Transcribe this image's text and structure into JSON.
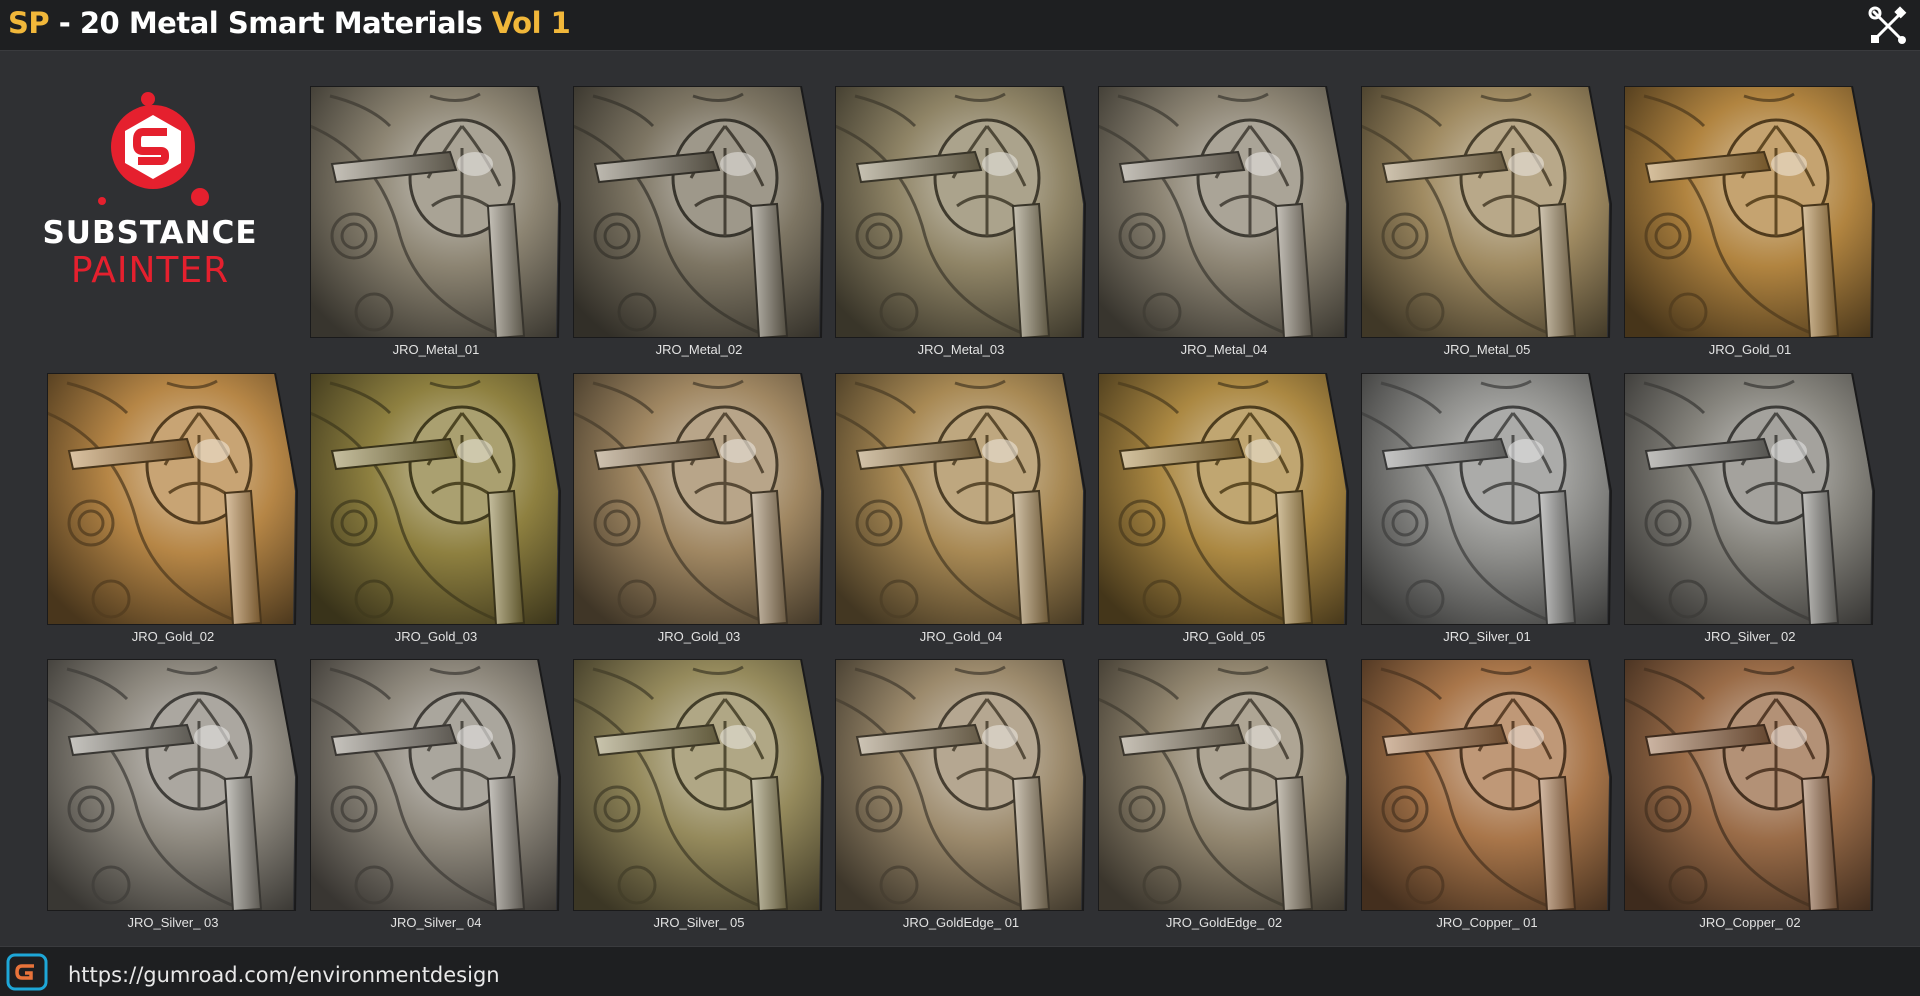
{
  "header": {
    "title_sp": "SP",
    "title_main": " - 20 Metal Smart Materials ",
    "title_vol": "Vol 1",
    "tools_icon": "tools-icon"
  },
  "logo": {
    "line1": "SUBSTANCE",
    "line2": "PAINTER",
    "brand_red": "#e5202e"
  },
  "colors": {
    "accent": "#f1b73a",
    "background": "#2f3033",
    "bar": "#1e1f21"
  },
  "materials": [
    {
      "label": "JRO_Metal_01",
      "tint": "#8c8472"
    },
    {
      "label": "JRO_Metal_02",
      "tint": "#7d7563"
    },
    {
      "label": "JRO_Metal_03",
      "tint": "#8f8466"
    },
    {
      "label": "JRO_Metal_04",
      "tint": "#8d8574"
    },
    {
      "label": "JRO_Metal_05",
      "tint": "#a08b62"
    },
    {
      "label": "JRO_Gold_01",
      "tint": "#b18440"
    },
    {
      "label": "JRO_Gold_02",
      "tint": "#b68646"
    },
    {
      "label": "JRO_Gold_03",
      "tint": "#8e8040"
    },
    {
      "label": "JRO_Gold_03",
      "tint": "#a08762"
    },
    {
      "label": "JRO_Gold_04",
      "tint": "#a88954"
    },
    {
      "label": "JRO_Gold_05",
      "tint": "#ab8842"
    },
    {
      "label": "JRO_Silver_01",
      "tint": "#8f8f8c"
    },
    {
      "label": "JRO_Silver_ 02",
      "tint": "#85837c"
    },
    {
      "label": "JRO_Silver_ 03",
      "tint": "#8f8a80"
    },
    {
      "label": "JRO_Silver_ 04",
      "tint": "#8e887c"
    },
    {
      "label": "JRO_Silver_ 05",
      "tint": "#958a5c"
    },
    {
      "label": "JRO_GoldEdge_ 01",
      "tint": "#9c8a6c"
    },
    {
      "label": "JRO_GoldEdge_ 02",
      "tint": "#938770"
    },
    {
      "label": "JRO_Copper_ 01",
      "tint": "#a9764a"
    },
    {
      "label": "JRO_Copper_ 02",
      "tint": "#9a6c48"
    }
  ],
  "footer": {
    "url": "https://gumroad.com/environmentdesign",
    "icon": "gumroad-icon"
  }
}
